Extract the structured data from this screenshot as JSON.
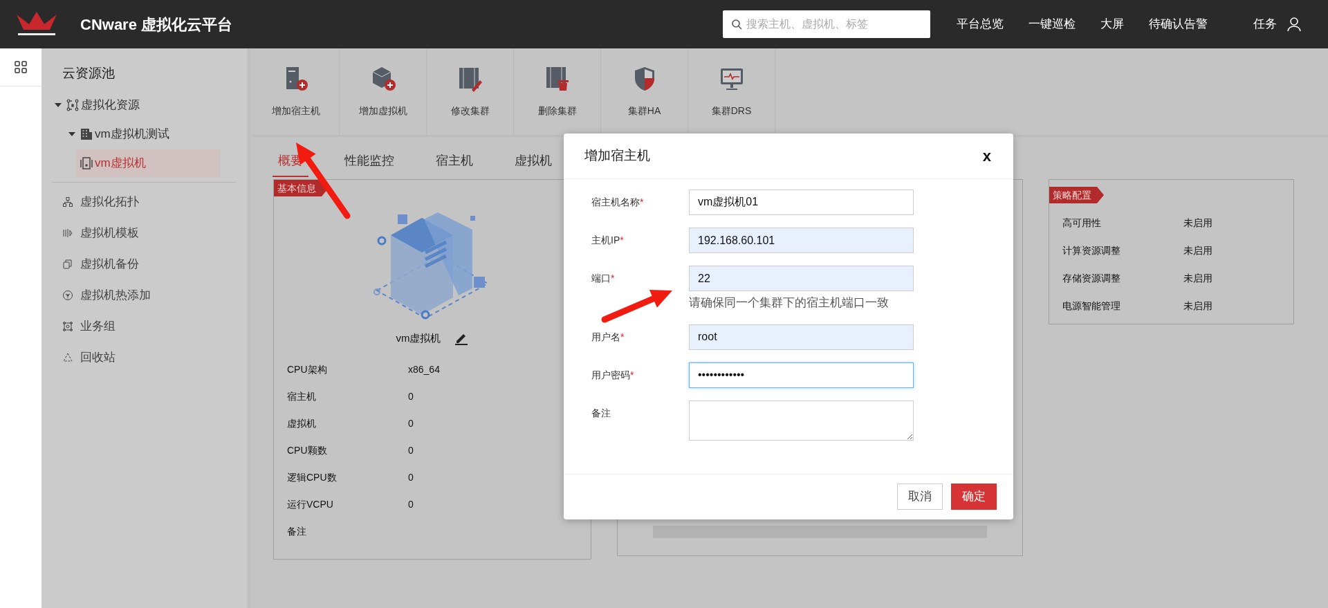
{
  "header": {
    "title": "CNware 虚拟化云平台",
    "search": {
      "placeholder": "搜索主机、虚拟机、标签"
    },
    "nav": [
      "平台总览",
      "一键巡检",
      "大屏",
      "待确认告警",
      "任务"
    ]
  },
  "sidebar": {
    "title": "云资源池",
    "tree": [
      {
        "label": "虚拟化资源",
        "expanded": true,
        "selected": false,
        "children": [
          {
            "label": "vm虚拟机测试",
            "expanded": true,
            "selected": false,
            "children": [
              {
                "label": "vm虚拟机",
                "selected": true
              }
            ]
          }
        ]
      }
    ],
    "items": [
      {
        "label": "虚拟化拓扑",
        "selected": false
      },
      {
        "label": "虚拟机模板",
        "selected": false
      },
      {
        "label": "虚拟机备份",
        "selected": false
      },
      {
        "label": "虚拟机热添加",
        "selected": false
      },
      {
        "label": "业务组",
        "selected": false
      },
      {
        "label": "回收站",
        "selected": false
      }
    ]
  },
  "toolbar": [
    "增加宿主机",
    "增加虚拟机",
    "修改集群",
    "删除集群",
    "集群HA",
    "集群DRS"
  ],
  "tabs": [
    {
      "label": "概要",
      "selected": true
    },
    {
      "label": "性能监控",
      "selected": false
    },
    {
      "label": "宿主机",
      "selected": false
    },
    {
      "label": "虚拟机",
      "selected": false
    }
  ],
  "basic_info": {
    "tag": "基本信息",
    "name": "vm虚拟机",
    "rows": [
      {
        "label": "CPU架构",
        "value": "x86_64"
      },
      {
        "label": "宿主机",
        "value": "0"
      },
      {
        "label": "虚拟机",
        "value": "0"
      },
      {
        "label": "CPU颗数",
        "value": "0"
      },
      {
        "label": "逻辑CPU数",
        "value": "0"
      },
      {
        "label": "运行VCPU",
        "value": "0"
      },
      {
        "label": "备注"
      }
    ]
  },
  "policy": {
    "tag": "策略配置",
    "rows": [
      {
        "label": "高可用性",
        "value": "未启用"
      },
      {
        "label": "计算资源调整",
        "value": "未启用"
      },
      {
        "label": "存储资源调整",
        "value": "未启用"
      },
      {
        "label": "电源智能管理",
        "value": "未启用"
      }
    ]
  },
  "dialog": {
    "title": "增加宿主机",
    "close": "x",
    "fields": [
      {
        "kind": "text",
        "label": "宿主机名称",
        "mark": "*",
        "value": "vm虚拟机01",
        "autofilled": false,
        "focused": false
      },
      {
        "kind": "text",
        "label": "主机IP",
        "mark": "*",
        "value": "192.168.60.101",
        "autofilled": true,
        "focused": false
      },
      {
        "kind": "text",
        "label": "端口",
        "mark": "*",
        "value": "22",
        "autofilled": true,
        "focused": false,
        "hint": "请确保同一个集群下的宿主机端口一致"
      },
      {
        "kind": "text",
        "label": "用户名",
        "mark": "*",
        "value": "root",
        "autofilled": true,
        "focused": false
      },
      {
        "kind": "password",
        "label": "用户密码",
        "mark": "*",
        "value": "••••••••••••",
        "autofilled": false,
        "focused": true
      },
      {
        "kind": "textarea",
        "label": "备注",
        "autofilled": false,
        "focused": false
      }
    ],
    "buttons": [
      {
        "label": "取消",
        "primary": false
      },
      {
        "label": "确定",
        "primary": true
      }
    ]
  }
}
